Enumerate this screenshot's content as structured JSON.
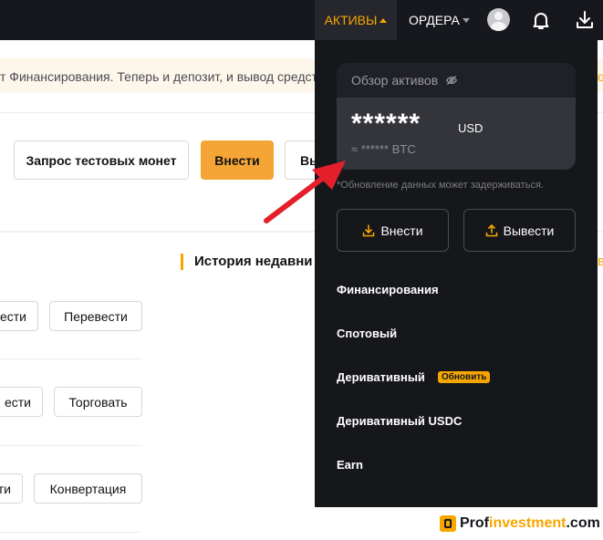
{
  "nav": {
    "assets_label": "АКТИВЫ",
    "orders_label": "ОРДЕРА"
  },
  "page": {
    "notice_text": "т Финансирования. Теперь и депозит, и вывод средств",
    "notice_tail": "об",
    "test_coins_button": "Запрос тестовых монет",
    "deposit_button": "Внести",
    "withdraw_button_partial": "Вы",
    "history_title": "История недавни",
    "history_tail": "в",
    "rows": [
      {
        "left_button": "ести",
        "right_button": "Перевести"
      },
      {
        "left_button": "ести",
        "right_button": "Торговать"
      },
      {
        "left_button": "ти",
        "right_button": "Конвертация"
      }
    ]
  },
  "dropdown": {
    "overview_label": "Обзор активов",
    "balance_masked": "******",
    "currency": "USD",
    "btc_masked": "≈ ****** BTC",
    "update_note": "*Обновление данных может задерживаться.",
    "deposit_button": "Внести",
    "withdraw_button": "Вывести",
    "menu": [
      {
        "label": "Финансирования"
      },
      {
        "label": "Спотовый"
      },
      {
        "label": "Деривативный",
        "badge": "Обновить"
      },
      {
        "label": "Деривативный USDC"
      },
      {
        "label": "Earn"
      }
    ]
  },
  "watermark": {
    "part1": "Prof",
    "part2": "investment",
    "part3": ".com"
  },
  "colors": {
    "accent": "#f7a600",
    "topbar": "#17181e",
    "dropdown_bg": "#16171b",
    "arrow": "#e3202a"
  }
}
